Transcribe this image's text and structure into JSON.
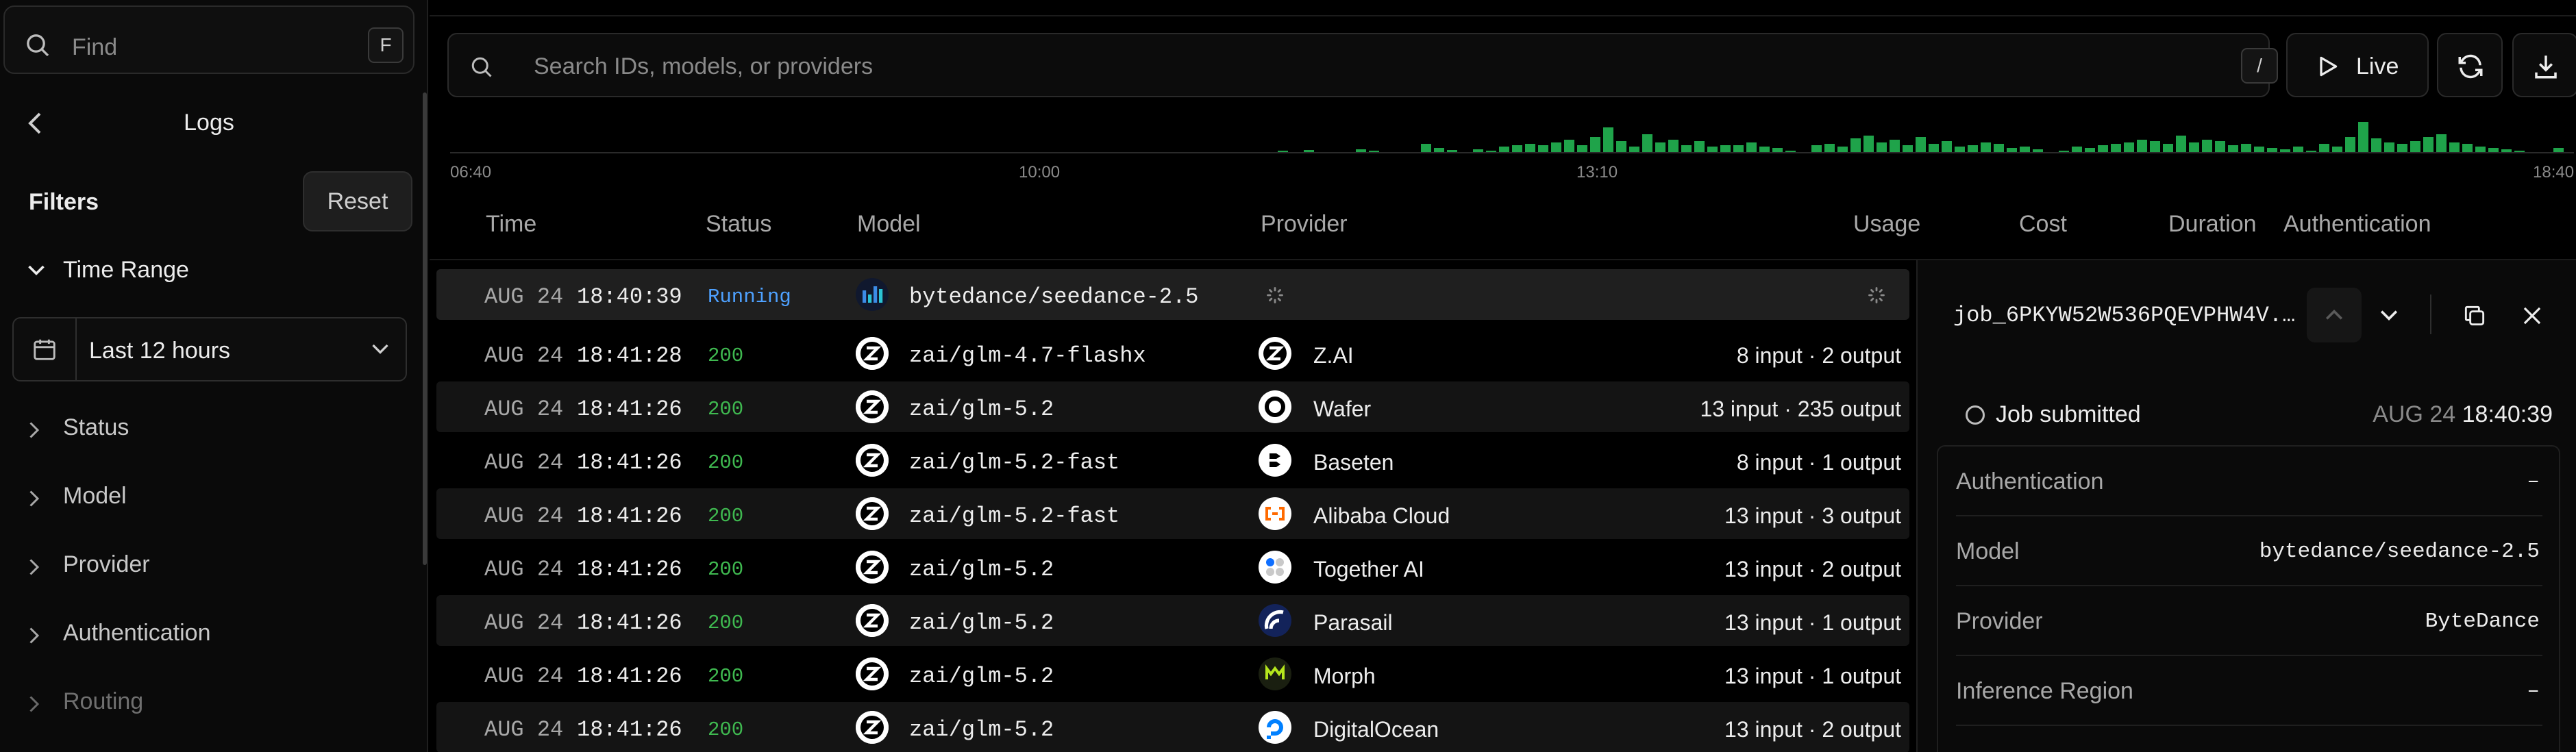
{
  "sidebar": {
    "find_placeholder": "Find",
    "find_shortcut": "F",
    "title": "Logs",
    "filters_label": "Filters",
    "reset_label": "Reset",
    "time_range_label": "Time Range",
    "time_range_value": "Last 12 hours",
    "sections": [
      "Status",
      "Model",
      "Provider",
      "Authentication",
      "Routing"
    ]
  },
  "toolbar": {
    "search_placeholder": "Search IDs, models, or providers",
    "search_shortcut": "/",
    "live_label": "Live"
  },
  "histogram": {
    "tick_labels": [
      "06:40",
      "10:00",
      "13:10",
      "18:40"
    ],
    "bar_color": "#1fa34a"
  },
  "table": {
    "columns": [
      "Time",
      "Status",
      "Model",
      "Provider",
      "Usage",
      "Cost",
      "Duration",
      "Authentication"
    ],
    "rows": [
      {
        "date": "AUG 24",
        "time": "18:40:39",
        "status": "Running",
        "model": "bytedance/seedance-2.5",
        "provider": "",
        "usage": ""
      },
      {
        "date": "AUG 24",
        "time": "18:41:28",
        "status": "200",
        "model": "zai/glm-4.7-flashx",
        "provider": "Z.AI",
        "usage": "8 input · 2 output"
      },
      {
        "date": "AUG 24",
        "time": "18:41:26",
        "status": "200",
        "model": "zai/glm-5.2",
        "provider": "Wafer",
        "usage": "13 input · 235 output"
      },
      {
        "date": "AUG 24",
        "time": "18:41:26",
        "status": "200",
        "model": "zai/glm-5.2-fast",
        "provider": "Baseten",
        "usage": "8 input · 1 output"
      },
      {
        "date": "AUG 24",
        "time": "18:41:26",
        "status": "200",
        "model": "zai/glm-5.2-fast",
        "provider": "Alibaba Cloud",
        "usage": "13 input · 3 output"
      },
      {
        "date": "AUG 24",
        "time": "18:41:26",
        "status": "200",
        "model": "zai/glm-5.2",
        "provider": "Together AI",
        "usage": "13 input · 2 output"
      },
      {
        "date": "AUG 24",
        "time": "18:41:26",
        "status": "200",
        "model": "zai/glm-5.2",
        "provider": "Parasail",
        "usage": "13 input · 1 output"
      },
      {
        "date": "AUG 24",
        "time": "18:41:26",
        "status": "200",
        "model": "zai/glm-5.2",
        "provider": "Morph",
        "usage": "13 input · 1 output"
      },
      {
        "date": "AUG 24",
        "time": "18:41:26",
        "status": "200",
        "model": "zai/glm-5.2",
        "provider": "DigitalOcean",
        "usage": "13 input · 2 output"
      }
    ]
  },
  "detail": {
    "job_id": "job_6PKYW52W536PQEVPHW4V...",
    "status_label": "Job submitted",
    "date": "AUG 24",
    "time": "18:40:39",
    "fields": [
      {
        "key": "Authentication",
        "value": "–"
      },
      {
        "key": "Model",
        "value": "bytedance/seedance-2.5"
      },
      {
        "key": "Provider",
        "value": "ByteDance"
      },
      {
        "key": "Inference Region",
        "value": "–"
      }
    ]
  },
  "colors": {
    "status_ok": "#3fb950",
    "status_running": "#4ea1ff",
    "background": "#000000",
    "panel": "#0a0a0a"
  }
}
